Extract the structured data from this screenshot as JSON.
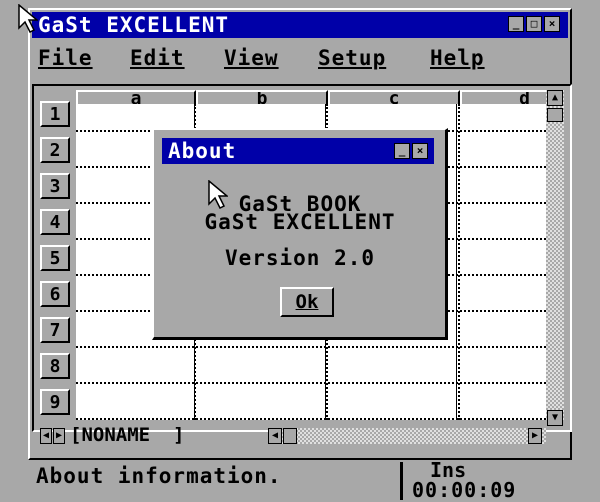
{
  "window": {
    "title": "GaSt EXCELLENT"
  },
  "menu": [
    {
      "label": "File"
    },
    {
      "label": "Edit"
    },
    {
      "label": "View"
    },
    {
      "label": "Setup"
    },
    {
      "label": "Help"
    }
  ],
  "sheet": {
    "columns": [
      "a",
      "b",
      "c",
      "d"
    ],
    "rows": [
      "1",
      "2",
      "3",
      "4",
      "5",
      "6",
      "7",
      "8",
      "9"
    ],
    "tab_name": "[NONAME  ]"
  },
  "dialog": {
    "title": "About",
    "line1": "GaSt BOOK",
    "line2": "GaSt EXCELLENT",
    "version": "Version 2.0",
    "ok_label": "Ok"
  },
  "status": {
    "message": "About information.",
    "mode": "Ins",
    "time": "00:00:09"
  }
}
